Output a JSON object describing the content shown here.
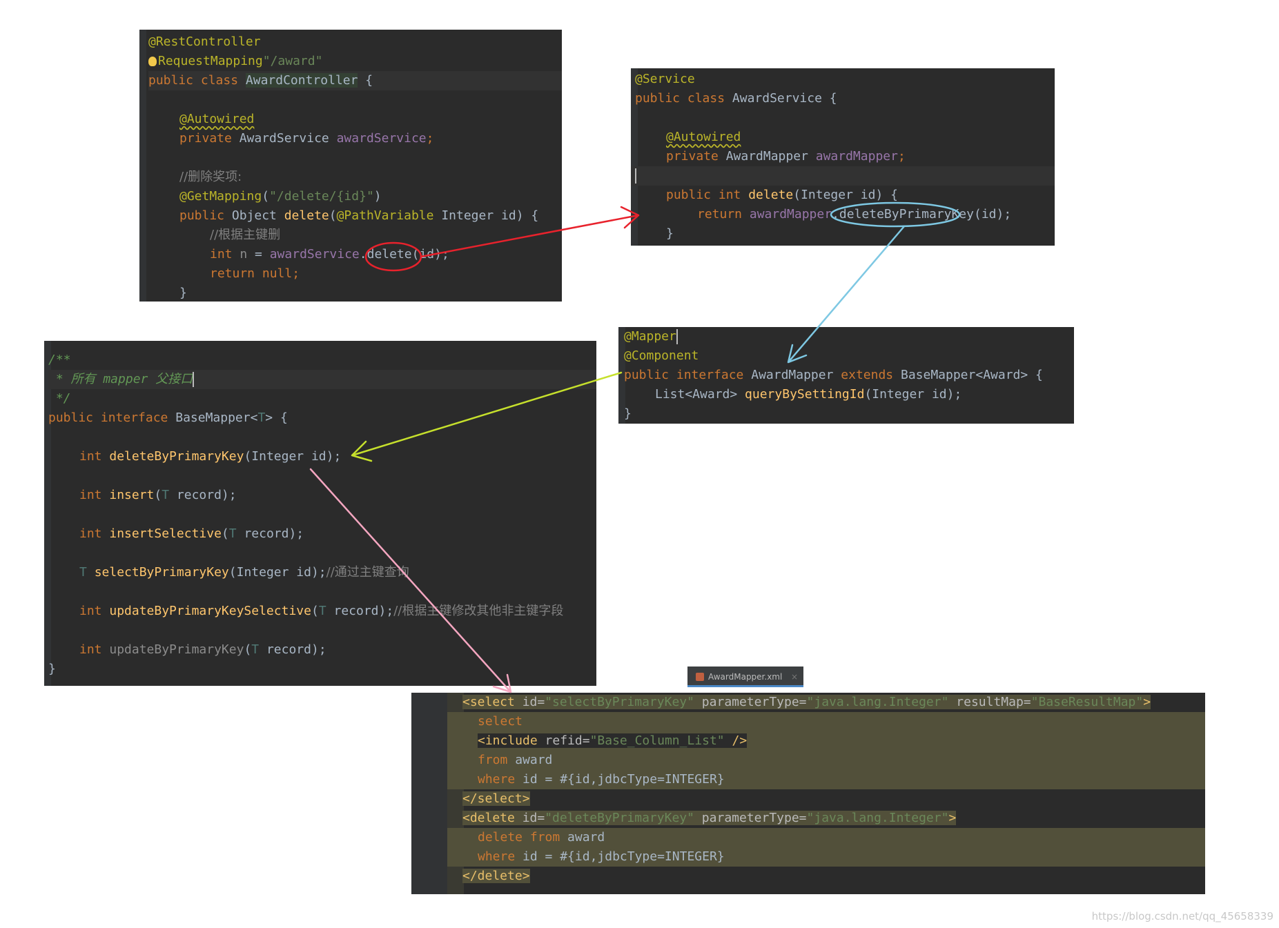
{
  "controller": {
    "ann_rest": "@RestController",
    "ann_rm_at": "@",
    "ann_rm_rest": "RequestMapping",
    "rm_path": "\"/award\"",
    "kw_public_class": "public class ",
    "class_name": "AwardController",
    "brace": " {",
    "autowired": "@Autowired",
    "kw_private": "private ",
    "type_service": "AwardService ",
    "field_service": "awardService",
    "comment_delete": "//删除奖项:",
    "getmapping": "@GetMapping",
    "get_path": "\"/delete/{id}\"",
    "kw_public": "public ",
    "method_sig_pre": "Object ",
    "method_delete": "delete",
    "pathvariable": "@PathVariable",
    "method_sig_post": " Integer id) {",
    "comment_pk": "//根据主键删",
    "kw_int": "int ",
    "var_n": "n",
    "assign": " = ",
    "call": ".delete(id);",
    "kw_return": "return ",
    "kw_null": "null",
    "close": "}"
  },
  "service": {
    "ann_service": "@Service",
    "kw_public_class": "public class ",
    "class_name": "AwardService {",
    "autowired": "@Autowired",
    "kw_private": "private ",
    "type_mapper": "AwardMapper ",
    "field_mapper": "awardMapper",
    "kw_public_int": "public int ",
    "method_delete": "delete",
    "params": "(Integer id) {",
    "kw_return": "return ",
    "call": ".deleteByPrimaryKey(id);",
    "close": "}"
  },
  "mapper": {
    "ann_mapper": "@Mapper",
    "ann_component": "@Component",
    "kw_public_interface": "public interface ",
    "name": "AwardMapper ",
    "kw_extends": "extends ",
    "base": "BaseMapper<Award> {",
    "list_type": "List<Award> ",
    "method": "queryBySettingId",
    "params": "(Integer id);",
    "close": "}"
  },
  "basemapper": {
    "doc_open": "/**",
    "doc_line": " * 所有 mapper 父接口",
    "doc_close": " */",
    "kw_public_interface": "public interface ",
    "name": "BaseMapper<",
    "type_t": "T",
    "name_close": "> {",
    "kw_int": "int ",
    "m1": "deleteByPrimaryKey",
    "m1_params": "(Integer id);",
    "m2": "insert",
    "m2_params_pre": "(",
    "m2_params_post": " record);",
    "m3": "insertSelective",
    "m4_type": "T ",
    "m4": "selectByPrimaryKey",
    "m4_params": "(Integer id);",
    "m4_comment": "//通过主键查询",
    "m5": "updateByPrimaryKeySelective",
    "m5_comment": "//根据主键修改其他非主键字段",
    "m6": "updateByPrimaryKey",
    "close": "}"
  },
  "tab": {
    "label": "AwardMapper.xml",
    "close": "×"
  },
  "xml": {
    "select_open": "<select ",
    "attr_id": "id=",
    "val_select_id": "\"selectByPrimaryKey\"",
    "attr_param": " parameterType=",
    "val_param": "\"java.lang.Integer\"",
    "attr_result": " resultMap=",
    "val_result": "\"BaseResultMap\"",
    "tag_end": ">",
    "kw_select": "select",
    "include_open": "<include ",
    "attr_refid": "refid=",
    "val_refid": "\"Base_Column_List\"",
    "include_close": " />",
    "kw_from": "from ",
    "tbl_award": "award",
    "kw_where": "where ",
    "where_expr": "id = #{id,jdbcType=INTEGER}",
    "select_close": "</select>",
    "delete_open": "<delete ",
    "val_delete_id": "\"deleteByPrimaryKey\"",
    "kw_delete_from": "delete from ",
    "delete_close": "</delete>"
  },
  "watermark": "https://blog.csdn.net/qq_45658339",
  "colors": {
    "arrow_red": "#e8222c",
    "arrow_blue": "#7ec8e3",
    "arrow_yellow": "#c6e02c",
    "arrow_pink": "#f4a6c0"
  }
}
